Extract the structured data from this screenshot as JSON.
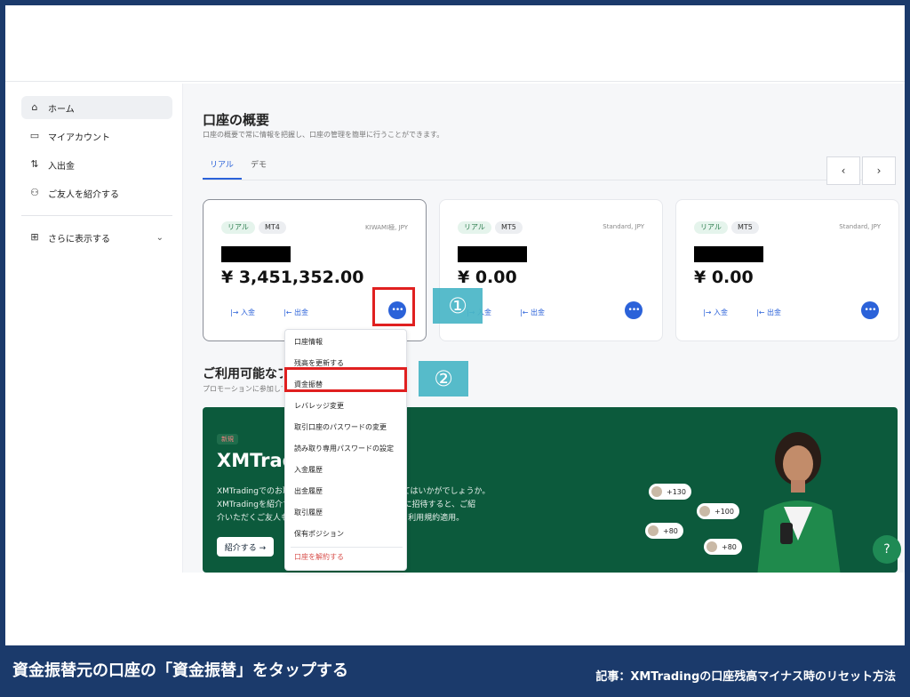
{
  "sidebar": {
    "items": [
      {
        "label": "ホーム"
      },
      {
        "label": "マイアカウント"
      },
      {
        "label": "入出金"
      },
      {
        "label": "ご友人を紹介する"
      }
    ],
    "more_label": "さらに表示する"
  },
  "overview": {
    "title": "口座の概要",
    "subtitle": "口座の概要で常に情報を把握し、口座の管理を簡単に行うことができます。",
    "tabs": [
      {
        "label": "リアル"
      },
      {
        "label": "デモ"
      }
    ]
  },
  "cards": [
    {
      "badge1": "リアル",
      "badge2": "MT4",
      "type": "KIWAMI極, JPY",
      "balance": "¥ 3,451,352.00",
      "deposit": "入金",
      "withdraw": "出金"
    },
    {
      "badge1": "リアル",
      "badge2": "MT5",
      "type": "Standard, JPY",
      "balance": "¥ 0.00",
      "deposit": "入金",
      "withdraw": "出金"
    },
    {
      "badge1": "リアル",
      "badge2": "MT5",
      "type": "Standard, JPY",
      "balance": "¥ 0.00",
      "deposit": "入金",
      "withdraw": "出金"
    }
  ],
  "menu": {
    "items": [
      "口座情報",
      "残高を更新する",
      "資金振替",
      "レバレッジ変更",
      "取引口座のパスワードの変更",
      "読み取り専用パスワードの設定",
      "入金履歴",
      "出金履歴",
      "取引履歴",
      "保有ポジション"
    ],
    "danger_item": "口座を解約する"
  },
  "promos": {
    "title": "ご利用可能なプロモーション",
    "subtitle": "プロモーションに参加して特典を受け取りましょう",
    "badge": "新規",
    "card_title": "XMTrading",
    "lines": [
      "XMTradingでのお取引をご友人にもおすすめしてみてはいかがでしょうか。",
      "XMTradingを紹介するだけで、ご友人をXMTradingに招待すると、ご紹",
      "介いただくご友人も特典を受け取ることができます。利用規約適用。"
    ],
    "button": "紹介する →",
    "pills": [
      "+130",
      "+100",
      "+80",
      "+80"
    ]
  },
  "annotations": {
    "step1": "①",
    "step2": "②"
  },
  "footer": {
    "left": "資金振替元の口座の「資金振替」をタップする",
    "right": "記事：XMTradingの口座残高マイナス時のリセット方法"
  },
  "colors": {
    "accent": "#2b62d9",
    "highlight": "#e02020",
    "step": "#49b6c7",
    "promo_bg": "#0c5a3c",
    "frame": "#1b3a6b"
  }
}
